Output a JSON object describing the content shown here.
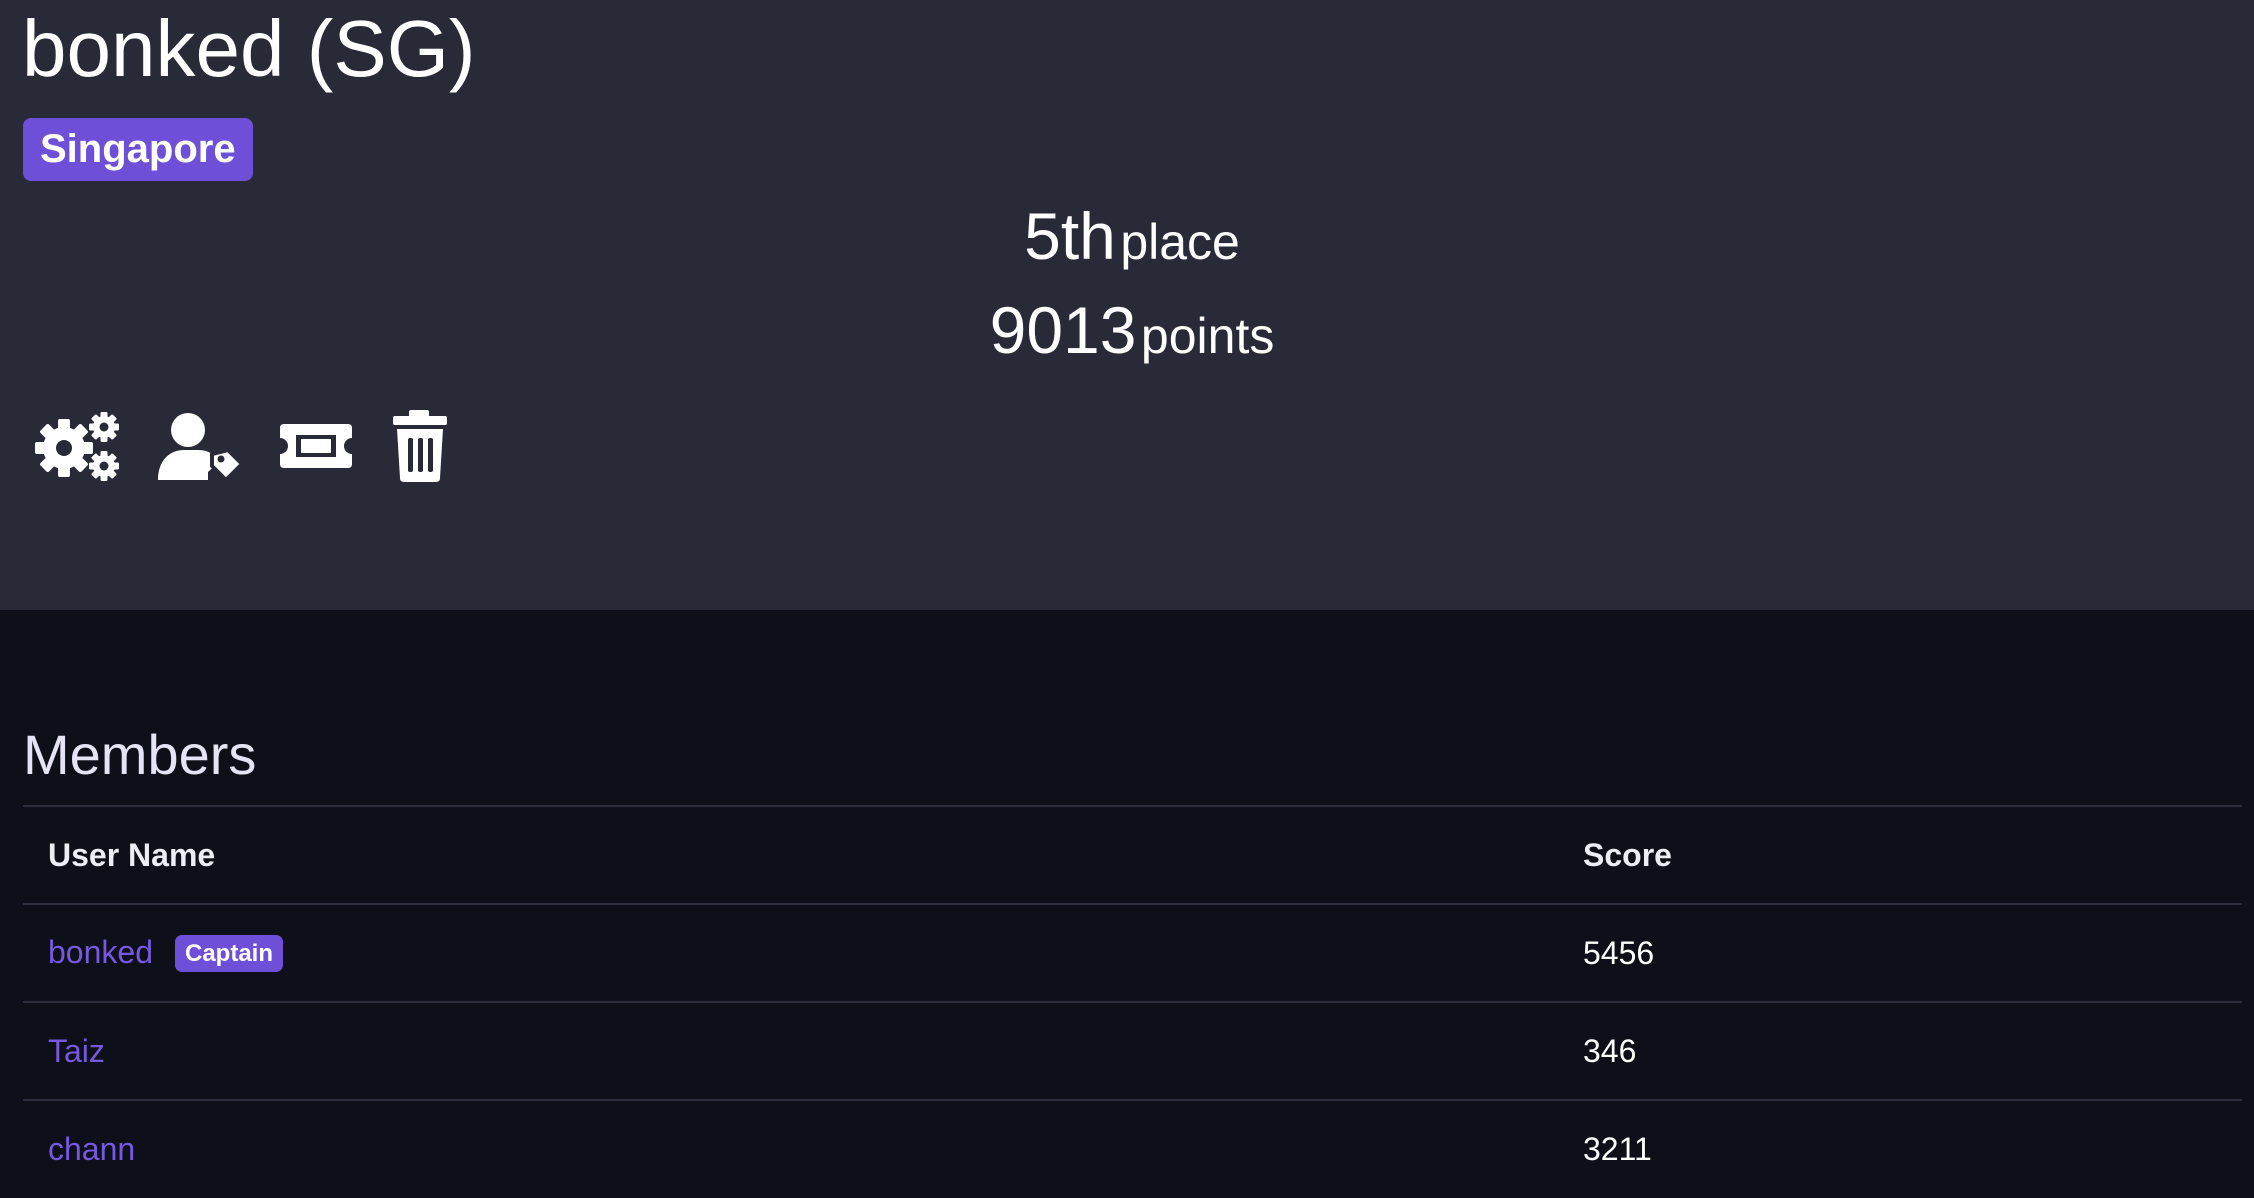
{
  "team": {
    "name": "bonked (SG)",
    "country": "Singapore",
    "place_value": "5th",
    "place_unit": "place",
    "points_value": "9013",
    "points_unit": "points"
  },
  "actions": [
    {
      "icon": "settings-gears-icon"
    },
    {
      "icon": "user-tag-icon"
    },
    {
      "icon": "ticket-icon"
    },
    {
      "icon": "trash-icon"
    }
  ],
  "members": {
    "title": "Members",
    "columns": [
      "User Name",
      "Score"
    ],
    "rows": [
      {
        "name": "bonked",
        "badge": "Captain",
        "score": "5456"
      },
      {
        "name": "Taiz",
        "badge": "",
        "score": "346"
      },
      {
        "name": "chann",
        "badge": "",
        "score": "3211"
      }
    ]
  },
  "colors": {
    "accent": "#6e4fd8",
    "link": "#7559e0",
    "hero_bg": "#282a37",
    "page_bg": "#0e0f18"
  }
}
